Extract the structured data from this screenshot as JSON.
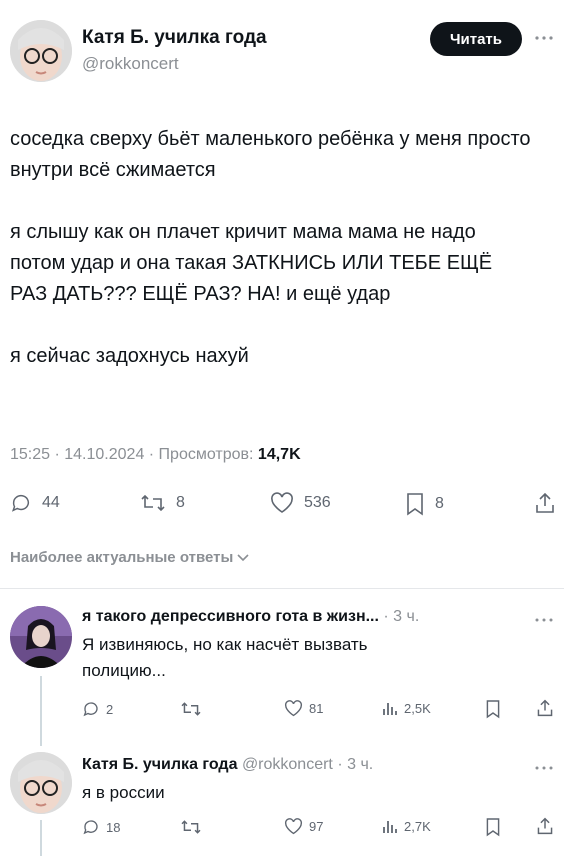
{
  "tweet": {
    "author_name": "Катя Б. училка года",
    "author_handle": "@rokkoncert",
    "follow_label": "Читать",
    "paragraphs": [
      "соседка сверху бьёт маленького ребёнка у меня просто внутри всё сжимается",
      "я слышу как он плачет кричит мама мама не надо потом удар и она такая ЗАТКНИСЬ ИЛИ ТЕБЕ ЕЩЁ РАЗ ДАТЬ??? ЕЩЁ РАЗ? НА! и ещё удар",
      "я сейчас задохнусь нахуй"
    ],
    "meta_time_date": "15:25 · 14.10.2024 · Просмотров:",
    "meta_views": "14,7K",
    "stats": {
      "replies": "44",
      "retweets": "8",
      "likes": "536",
      "bookmarks": "8"
    }
  },
  "sort_label": "Наиболее актуальные ответы",
  "replies": [
    {
      "name": "я такого депрессивного гота в жизн...",
      "handle": "",
      "time": "· 3 ч.",
      "text": "Я извиняюсь, но как насчёт вызвать полицию...",
      "stats": {
        "replies": "2",
        "retweets": "",
        "likes": "81",
        "views": "2,5K"
      }
    },
    {
      "name": "Катя Б. училка года",
      "handle": "@rokkoncert",
      "time": "· 3 ч.",
      "text": "я в россии",
      "stats": {
        "replies": "18",
        "retweets": "",
        "likes": "97",
        "views": "2,7K"
      }
    }
  ],
  "colors": {
    "text": "#0f1419",
    "muted": "#8b8f94",
    "button_bg": "#0f1419",
    "thread_line": "#cfd9de"
  },
  "icons": [
    "reply-icon",
    "retweet-icon",
    "like-icon",
    "bookmark-icon",
    "share-icon",
    "views-icon",
    "more-icon",
    "chevron-down-icon"
  ]
}
